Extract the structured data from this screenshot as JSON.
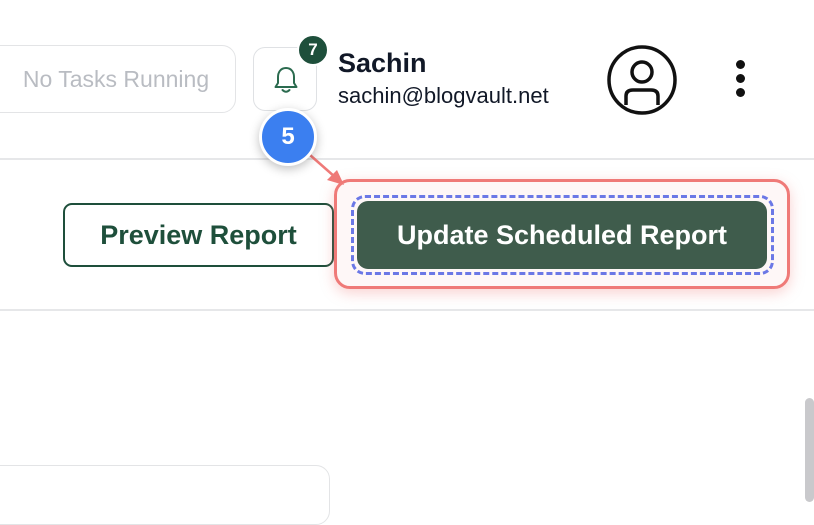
{
  "header": {
    "task_status": "No Tasks Running",
    "notification_count": "7",
    "user": {
      "name": "Sachin",
      "email": "sachin@blogvault.net"
    }
  },
  "annotation": {
    "step_number": "5"
  },
  "actions": {
    "preview_label": "Preview Report",
    "update_label": "Update Scheduled Report"
  },
  "icons": {
    "bell": "bell-icon",
    "avatar": "user-avatar-icon",
    "more": "more-vertical-icon"
  },
  "colors": {
    "brand_green": "#1e4f3b",
    "button_dark": "#3f5c4c",
    "highlight": "#ef7a78",
    "focus_dashed": "#6b78e6",
    "step_blue": "#3b7ff0"
  }
}
